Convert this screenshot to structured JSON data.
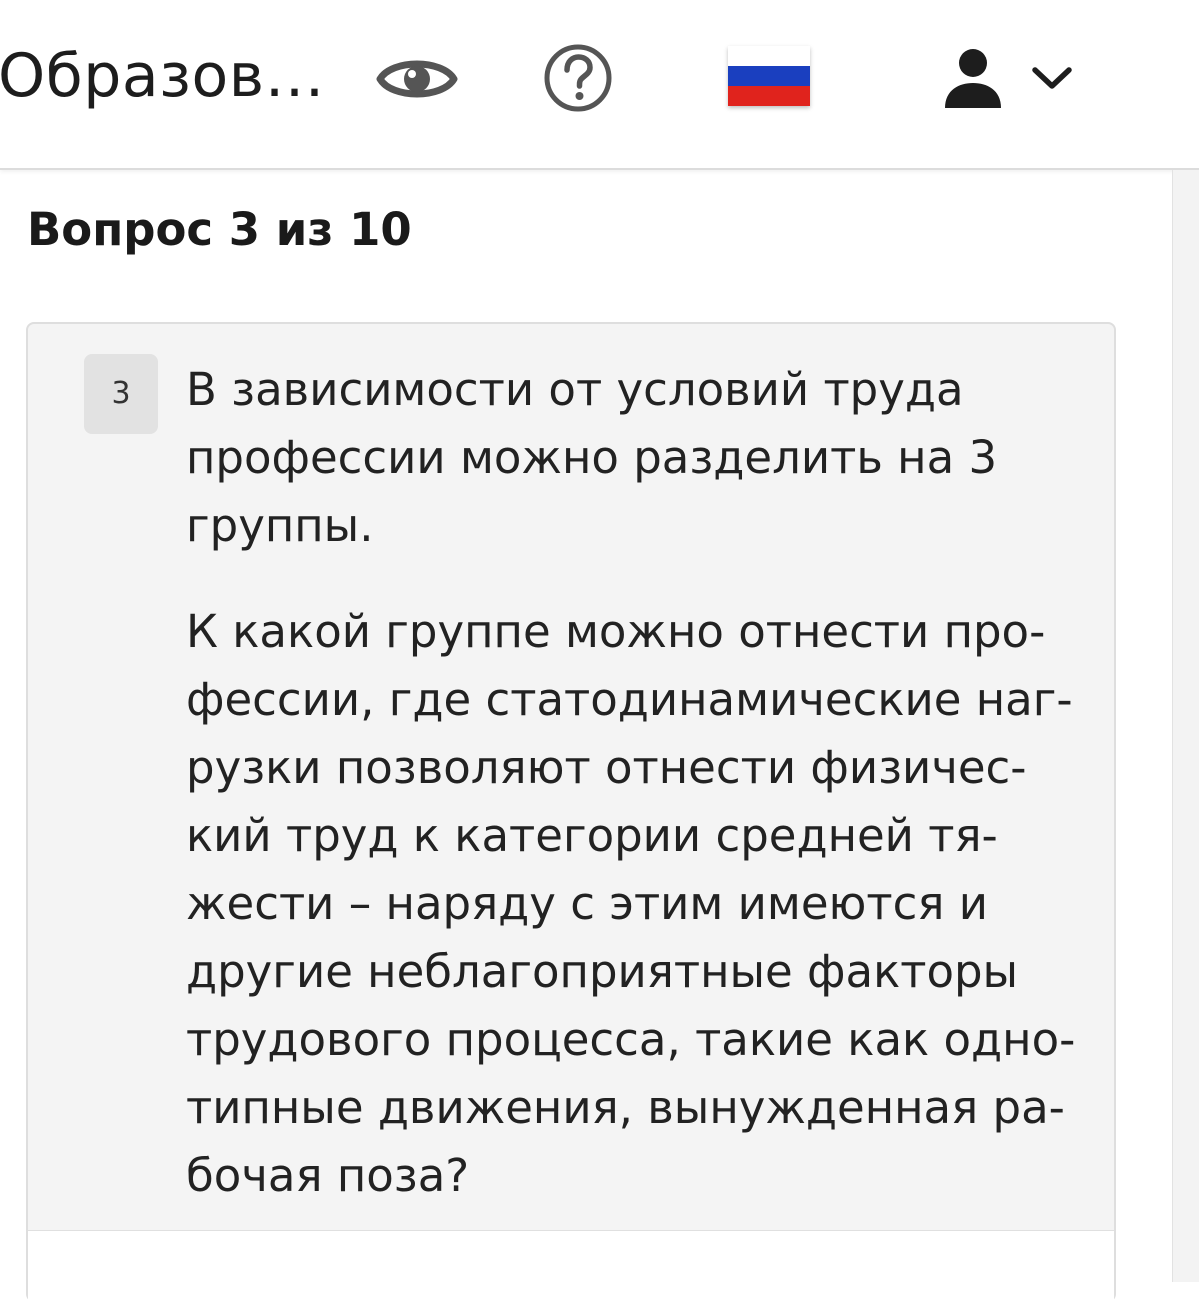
{
  "header": {
    "title": "Образов…",
    "icons": {
      "preview": "eye-icon",
      "help": "help-circle-icon",
      "language": "russia-flag-icon",
      "user": "user-icon",
      "menu": "chevron-down-icon"
    },
    "flag_colors": [
      "#ffffff",
      "#1a3fbf",
      "#e0231d"
    ]
  },
  "quiz": {
    "progress": "Вопрос 3 из 10",
    "question": {
      "number": "3",
      "intro_lines": [
        "В зависимости от условий труда",
        "профессии можно разделить на 3",
        "группы."
      ],
      "body_lines": [
        "К какой группе можно отнести про-",
        "фессии, где статодинамические наг-",
        "рузки позволяют отнести физичес-",
        "кий труд к категории средней тя-",
        "жести – наряду с этим имеются и",
        "другие неблагоприятные факторы",
        "трудового процесса, такие как одно-",
        "типные движения, вынужденная ра-",
        "бочая поза?"
      ]
    }
  }
}
